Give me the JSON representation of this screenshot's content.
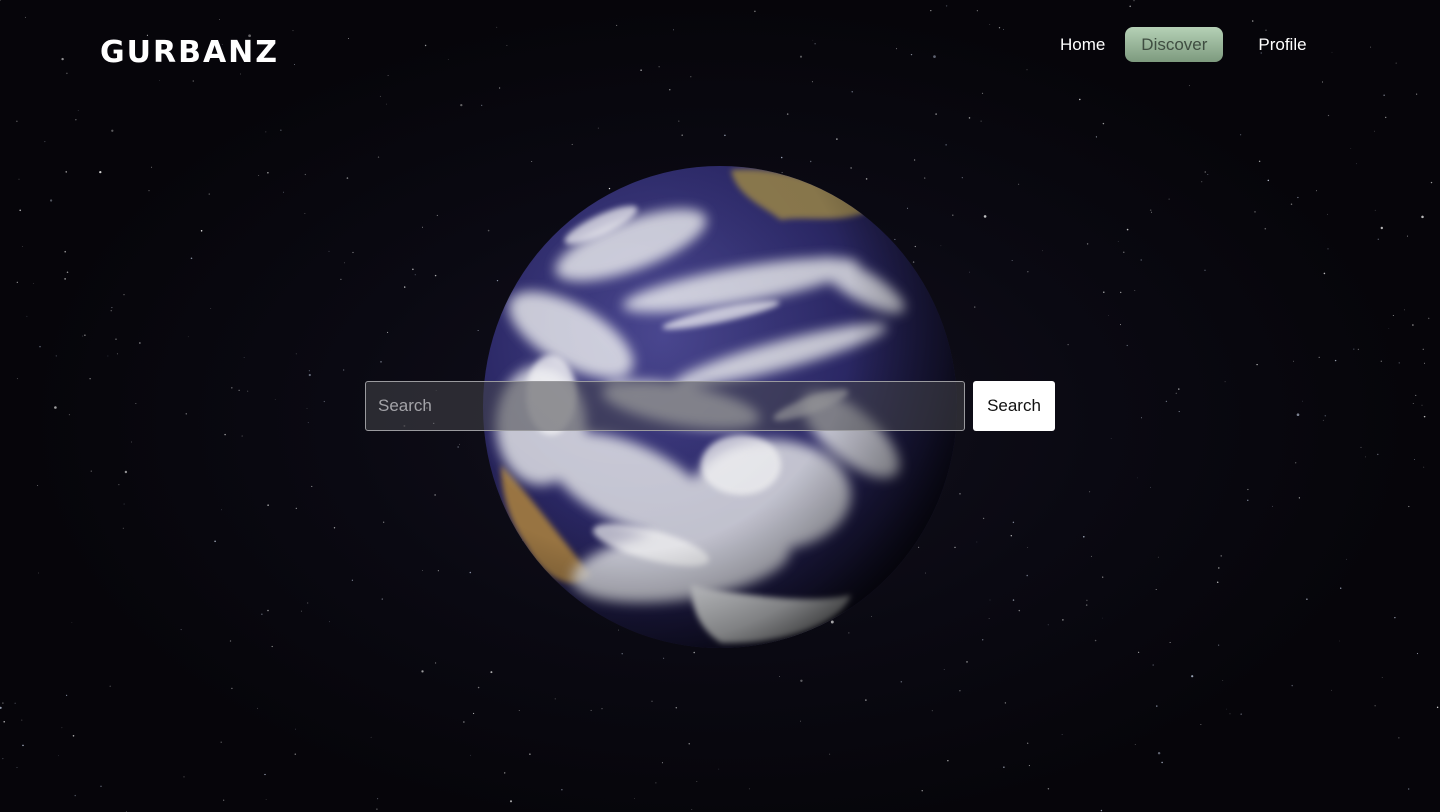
{
  "brand": {
    "logo_text": "GURBANZ"
  },
  "nav": {
    "items": [
      {
        "label": "Home",
        "active": false
      },
      {
        "label": "Discover",
        "active": true
      },
      {
        "label": "Profile",
        "active": false
      }
    ]
  },
  "search": {
    "placeholder": "Search",
    "value": "",
    "button_label": "Search"
  },
  "colors": {
    "background": "#07060c",
    "active_nav_top": "#b5d1b6",
    "active_nav_bottom": "#7d9a7e",
    "button_bg": "#ffffff",
    "ocean": "#2f2c6e",
    "cloud": "#e8e9ee",
    "land": "#9c7a4a"
  },
  "imagery": {
    "background": "starfield-image",
    "hero": "earth-globe-image"
  }
}
